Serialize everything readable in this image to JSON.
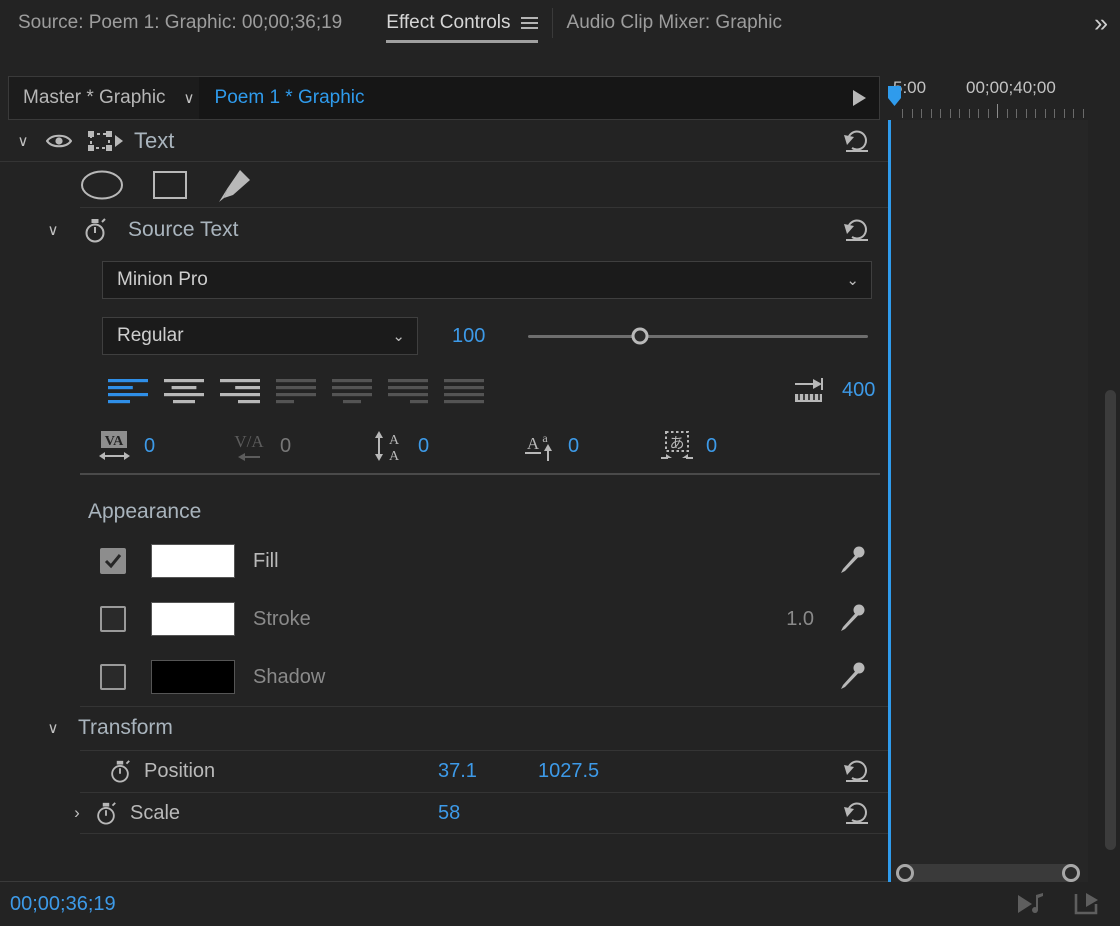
{
  "tabs": {
    "source_tab": "Source: Poem 1: Graphic: 00;00;36;19",
    "active_tab": "Effect Controls",
    "audio_tab": "Audio Clip Mixer: Graphic",
    "overflow_icon": "»",
    "menu_icon": "hamburger-icon"
  },
  "selector": {
    "master": "Master * Graphic",
    "chevron": "∨",
    "clip": "Poem 1 * Graphic"
  },
  "ruler": {
    "labels": [
      "5:00",
      "00;00;40;00"
    ],
    "playhead_time": "00;00;36;19"
  },
  "layer": {
    "disclosure": "∨",
    "eye_icon": "eye-icon",
    "transform_icon": "motion-bounding-box-icon",
    "name": "Text",
    "reset_icon": "reset-icon"
  },
  "shape_tools": [
    {
      "name": "ellipse-tool",
      "label": "Ellipse"
    },
    {
      "name": "rectangle-tool",
      "label": "Rectangle"
    },
    {
      "name": "pen-tool",
      "label": "Pen"
    }
  ],
  "source_text": {
    "disclosure": "∨",
    "stopwatch_icon": "stopwatch-icon",
    "label": "Source Text",
    "reset_icon": "reset-icon",
    "font_family": "Minion Pro",
    "font_style": "Regular",
    "font_size": "100",
    "font_size_pct": 33,
    "tab_width": "400",
    "tab_width_icon": "tab-width-icon"
  },
  "alignment": {
    "active_index": 0,
    "buttons": [
      {
        "name": "align-left",
        "label": "Align Left",
        "enabled": true
      },
      {
        "name": "align-center",
        "label": "Align Center",
        "enabled": true
      },
      {
        "name": "align-right",
        "label": "Align Right",
        "enabled": true
      },
      {
        "name": "justify-last-left",
        "label": "Justify Last Left",
        "enabled": false
      },
      {
        "name": "justify-last-center",
        "label": "Justify Last Center",
        "enabled": false
      },
      {
        "name": "justify-last-right",
        "label": "Justify Last Right",
        "enabled": false
      },
      {
        "name": "justify-all",
        "label": "Justify All",
        "enabled": false
      }
    ]
  },
  "metrics": [
    {
      "name": "tracking",
      "icon": "tracking-icon",
      "value": "0",
      "enabled": true
    },
    {
      "name": "kerning",
      "icon": "kerning-icon",
      "value": "0",
      "enabled": false
    },
    {
      "name": "leading",
      "icon": "leading-icon",
      "value": "0",
      "enabled": true
    },
    {
      "name": "baseline-shift",
      "icon": "baseline-shift-icon",
      "value": "0",
      "enabled": true
    },
    {
      "name": "tsume",
      "icon": "tsume-icon",
      "value": "0",
      "enabled": true
    }
  ],
  "appearance": {
    "title": "Appearance",
    "rows": [
      {
        "name": "fill",
        "label": "Fill",
        "checked": true,
        "color": "#ffffff",
        "value": "",
        "eyedropper": "eyedropper-icon",
        "enabled": true
      },
      {
        "name": "stroke",
        "label": "Stroke",
        "checked": false,
        "color": "#ffffff",
        "value": "1.0",
        "eyedropper": "eyedropper-icon",
        "enabled": false
      },
      {
        "name": "shadow",
        "label": "Shadow",
        "checked": false,
        "color": "#000000",
        "value": "",
        "eyedropper": "eyedropper-icon",
        "enabled": false
      }
    ]
  },
  "transform": {
    "disclosure": "∨",
    "title": "Transform",
    "rows": [
      {
        "name": "position",
        "label": "Position",
        "stopwatch": "stopwatch-icon",
        "values": [
          "37.1",
          "1027.5"
        ],
        "reset": "reset-icon",
        "expandable": false
      },
      {
        "name": "scale",
        "label": "Scale",
        "stopwatch": "stopwatch-icon",
        "values": [
          "58"
        ],
        "reset": "reset-icon",
        "expandable": true,
        "expand_chevron": "›"
      }
    ]
  },
  "status": {
    "timecode": "00;00;36;19",
    "icons": [
      {
        "name": "play-audio-icon",
        "label": "Play Audio"
      },
      {
        "name": "export-frame-icon",
        "label": "Export Frame"
      }
    ]
  },
  "colors": {
    "accent_blue": "#3d9ae8",
    "panel_bg": "#232323",
    "field_bg": "#1b1b1b"
  }
}
